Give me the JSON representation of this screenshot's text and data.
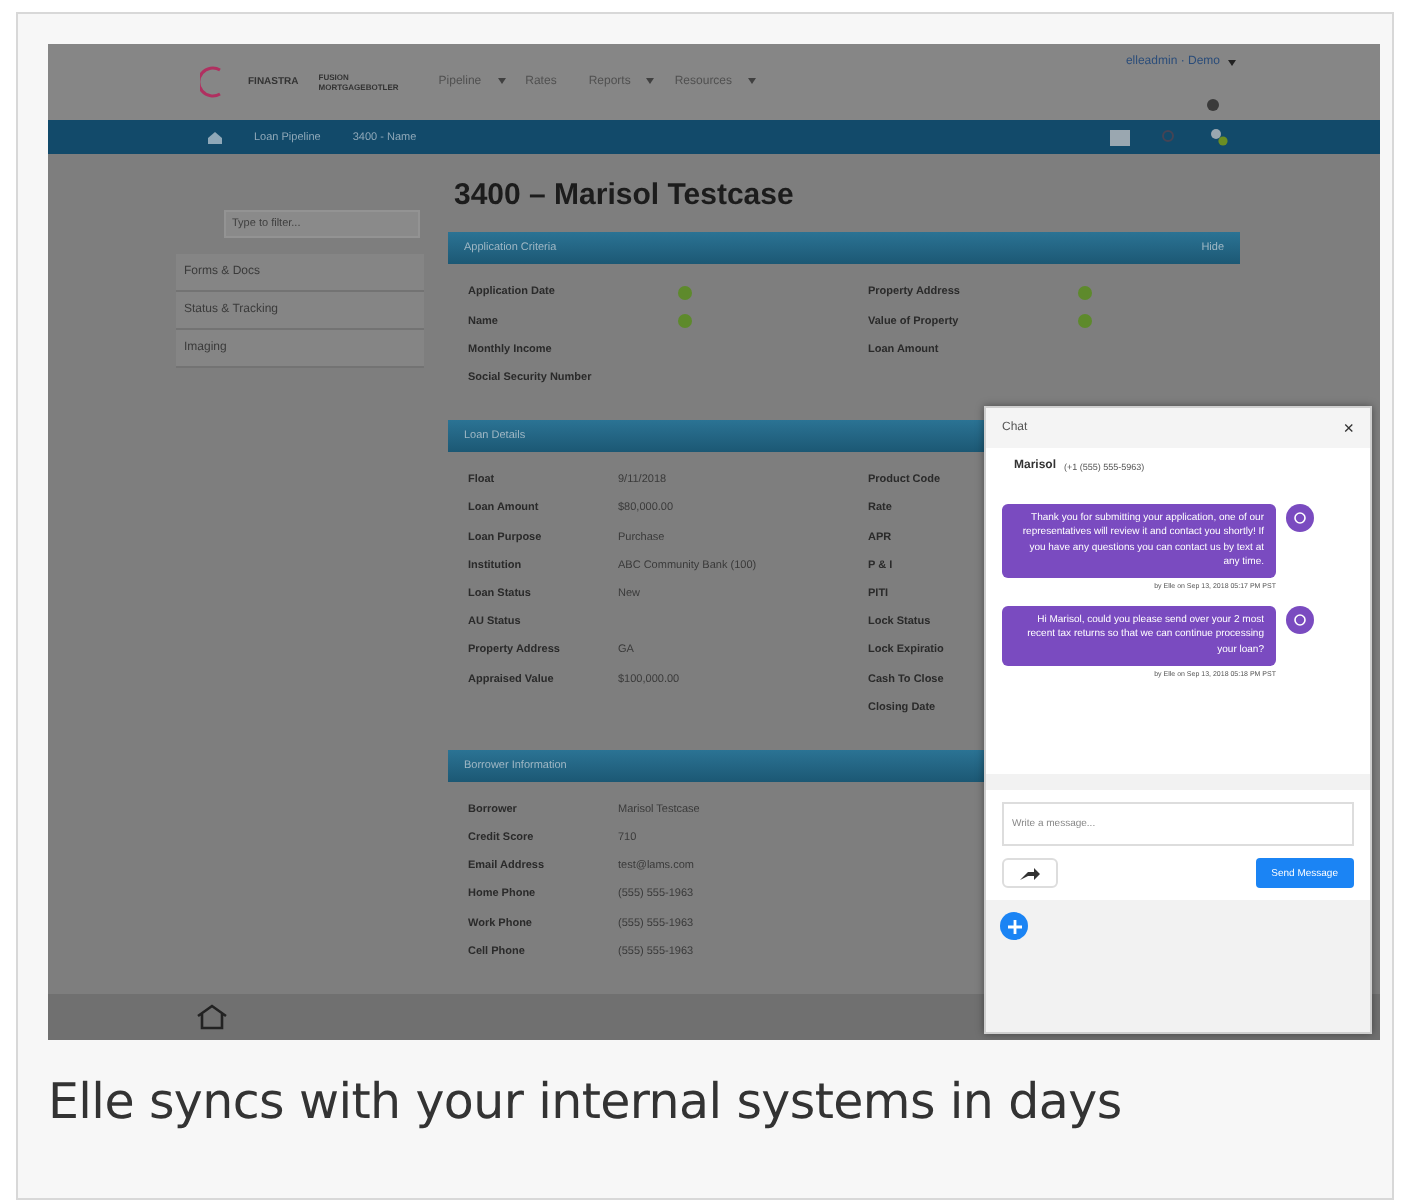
{
  "app": {
    "brand": "FINASTRA",
    "product": "FUSION MORTGAGEBOTLER",
    "nav": [
      {
        "label": "Pipeline",
        "dropdown": true
      },
      {
        "label": "Rates",
        "dropdown": false
      },
      {
        "label": "Reports",
        "dropdown": true
      },
      {
        "label": "Resources",
        "dropdown": true
      }
    ],
    "user": "elleadmin · Demo",
    "breadcrumbs": [
      "Loan Pipeline",
      "3400 - Name"
    ],
    "sidebar": {
      "placeholder": "Type to filter...",
      "items": [
        "Forms & Docs",
        "Status & Tracking",
        "Imaging"
      ]
    },
    "title": "3400 – Marisol Testcase",
    "panels": [
      {
        "title": "Application Criteria",
        "action": "Hide",
        "left": [
          {
            "label": "Application Date",
            "done": true
          },
          {
            "label": "Name",
            "done": true
          },
          {
            "label": "Monthly Income",
            "done": false
          },
          {
            "label": "Social Security Number",
            "done": false
          }
        ],
        "right": [
          {
            "label": "Property Address",
            "done": true
          },
          {
            "label": "Value of Property",
            "done": true
          },
          {
            "label": "Loan Amount",
            "done": false
          }
        ]
      },
      {
        "title": "Loan Details",
        "left": [
          {
            "label": "Float",
            "value": "9/11/2018"
          },
          {
            "label": "Loan Amount",
            "value": "$80,000.00"
          },
          {
            "label": "Loan Purpose",
            "value": "Purchase"
          },
          {
            "label": "Institution",
            "value": "ABC Community Bank (100)"
          },
          {
            "label": "Loan Status",
            "value": "New"
          },
          {
            "label": "AU Status"
          },
          {
            "label": "Property Address",
            "value": "GA"
          },
          {
            "label": "Appraised Value",
            "value": "$100,000.00"
          }
        ],
        "right": [
          {
            "label": "Product Code"
          },
          {
            "label": "Rate"
          },
          {
            "label": "APR"
          },
          {
            "label": "P & I"
          },
          {
            "label": "PITI"
          },
          {
            "label": "Lock Status"
          },
          {
            "label": "Lock Expiratio"
          },
          {
            "label": "Cash To Close"
          },
          {
            "label": "Closing Date"
          }
        ]
      },
      {
        "title": "Borrower Information",
        "left": [
          {
            "label": "Borrower",
            "value": "Marisol Testcase"
          },
          {
            "label": "Credit Score",
            "value": "710"
          },
          {
            "label": "Email Address",
            "value": "test@lams.com"
          },
          {
            "label": "Home Phone",
            "value": "(555) 555-1963"
          },
          {
            "label": "Work Phone",
            "value": "(555) 555-1963"
          },
          {
            "label": "Cell Phone",
            "value": "(555) 555-1963"
          }
        ]
      }
    ],
    "chat": {
      "title": "Chat",
      "close": "×",
      "contact": "Marisol",
      "phone": "(+1 (555) 555-5963)",
      "messages": [
        {
          "text": "Thank you for submitting your application, one of our representatives will review it and contact you shortly! If you have any questions you can contact us by text at any time.",
          "meta": "by Elle on Sep 13, 2018 05:17 PM PST"
        },
        {
          "text": "Hi Marisol, could you please send over your 2 most recent tax returns so that we can continue processing your loan?",
          "meta": "by Elle on Sep 13, 2018 05:18 PM PST"
        }
      ],
      "placeholder": "Write a message...",
      "send": "Send Message"
    }
  },
  "caption": "Elle syncs with your internal systems in days"
}
